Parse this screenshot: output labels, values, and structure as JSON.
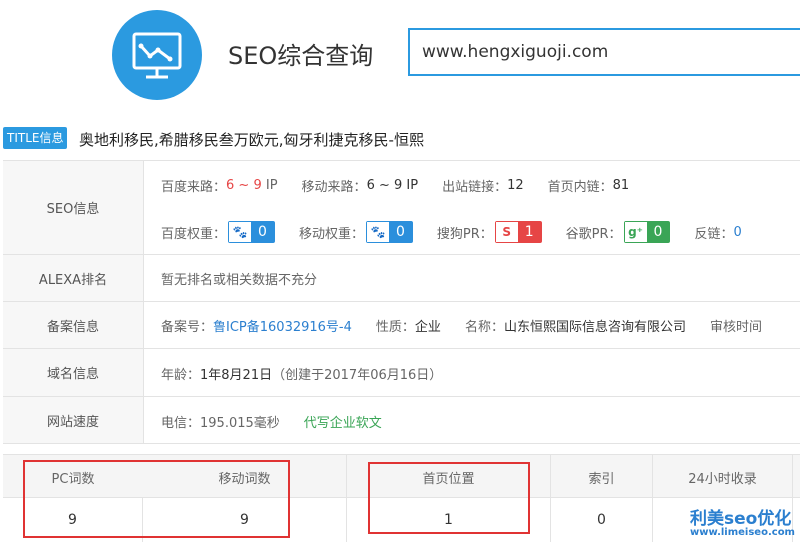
{
  "header": {
    "logo_icon": "chart-monitor-icon",
    "title": "SEO综合查询",
    "search_value": "www.hengxiguoji.com"
  },
  "title_row": {
    "badge": "TITLE信息",
    "text": "奥地利移民,希腊移民叁万欧元,匈牙利捷克移民-恒熙"
  },
  "seo": {
    "label": "SEO信息",
    "baidu_traffic_label": "百度来路：",
    "baidu_traffic_value": "6 ~ 9",
    "baidu_traffic_unit": "IP",
    "mobile_traffic_label": "移动来路：",
    "mobile_traffic_value": "6 ~ 9 IP",
    "outlinks_label": "出站链接：",
    "outlinks_value": "12",
    "inlinks_label": "首页内链：",
    "inlinks_value": "81",
    "baidu_weight_label": "百度权重：",
    "baidu_weight_value": "0",
    "mobile_weight_label": "移动权重：",
    "mobile_weight_value": "0",
    "sogou_pr_label": "搜狗PR：",
    "sogou_pr_value": "1",
    "google_pr_label": "谷歌PR：",
    "google_pr_value": "0",
    "backlinks_label": "反链：",
    "backlinks_value": "0"
  },
  "alexa": {
    "label": "ALEXA排名",
    "value": "暂无排名或相关数据不充分"
  },
  "beian": {
    "label": "备案信息",
    "number_label": "备案号：",
    "number_value": "鲁ICP备16032916号-4",
    "nature_label": "性质：",
    "nature_value": "企业",
    "name_label": "名称：",
    "name_value": "山东恒熙国际信息咨询有限公司",
    "review_label": "审核时间"
  },
  "domain": {
    "label": "域名信息",
    "age_label": "年龄：",
    "age_value": "1年8月21日",
    "created": "（创建于2017年06月16日）"
  },
  "speed": {
    "label": "网站速度",
    "telecom_label": "电信：",
    "telecom_value": "195.015毫秒",
    "ad_link": "代写企业软文"
  },
  "keywords": {
    "headers": [
      "PC词数",
      "移动词数",
      "首页位置",
      "索引",
      "24小时收录"
    ],
    "values": [
      "9",
      "9",
      "1",
      "0",
      ""
    ]
  },
  "watermark": {
    "main": "利美seo优化",
    "sub": "www.limeiseo.com"
  },
  "colors": {
    "accent": "#2b9ae0",
    "red": "#e64545",
    "green": "#3aa556",
    "highlight": "#e03333"
  }
}
